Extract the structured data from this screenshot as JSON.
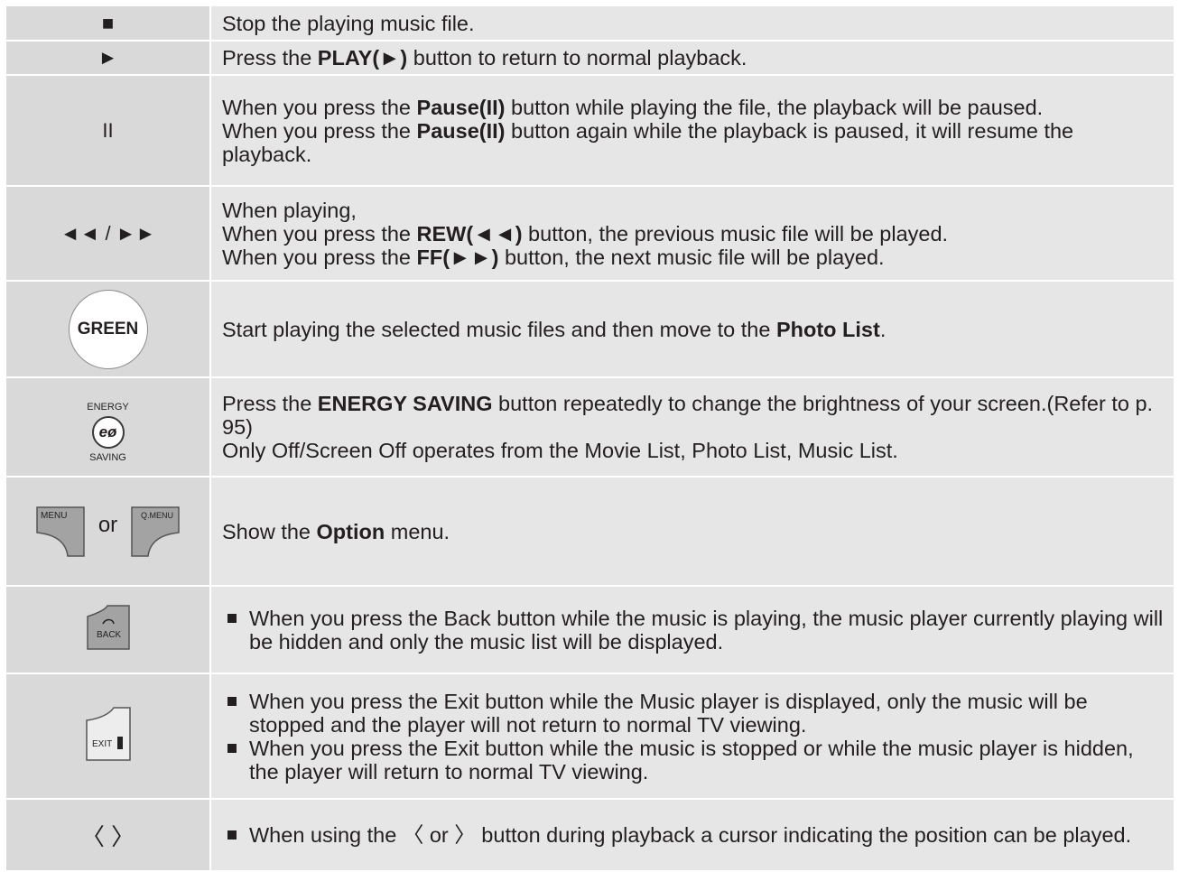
{
  "rows": [
    {
      "key": "■",
      "text": "Stop the playing music file."
    },
    {
      "key": "►",
      "pre": "Press the ",
      "bold": "PLAY(►)",
      "post": " button to return to normal playback."
    },
    {
      "key": "II",
      "l1pre": "When you press the ",
      "l1bold": "Pause(II)",
      "l1post": " button while playing the file, the playback will be paused.",
      "l2pre": "When you press the ",
      "l2bold": "Pause(II)",
      "l2post": " button again while the playback is paused, it will resume the playback."
    },
    {
      "key": "◄◄ / ►►",
      "l1": "When playing,",
      "l2pre": "When you press the ",
      "l2bold": "REW(◄◄)",
      "l2post": " button, the previous music file will be played.",
      "l3pre": "When you press the ",
      "l3bold": "FF(►►)",
      "l3post": " button, the next music file will be played."
    },
    {
      "key": "GREEN",
      "pre": "Start playing the selected music files and then move to the ",
      "bold": "Photo List",
      "post": "."
    },
    {
      "key_top": "ENERGY",
      "key_mid": "eø",
      "key_bottom": "SAVING",
      "pre": "Press the ",
      "bold": "ENERGY SAVING",
      "post": " button repeatedly to change the brightness of your screen.(Refer to p. 95)",
      "l2": "Only Off/Screen Off operates from the Movie List, Photo List, Music List."
    },
    {
      "key_left": "MENU",
      "key_or": "or",
      "key_right": "Q.MENU",
      "pre": "Show the ",
      "bold": "Option",
      "post": " menu."
    },
    {
      "key": "BACK",
      "b1": "When you press the Back button while the music is playing, the music player currently playing will be hidden and only the music list will be displayed."
    },
    {
      "key": "EXIT",
      "b1": "When you press the Exit button while the Music player is displayed, only the music will be stopped and the player will not return to normal TV viewing.",
      "b2": "When you press the Exit button while the music is stopped or while the music player is hidden, the player will return to normal TV viewing."
    },
    {
      "key": "〈 〉",
      "b1": "When using the 〈 or 〉 button during playback a cursor indicating the position can be played."
    }
  ]
}
